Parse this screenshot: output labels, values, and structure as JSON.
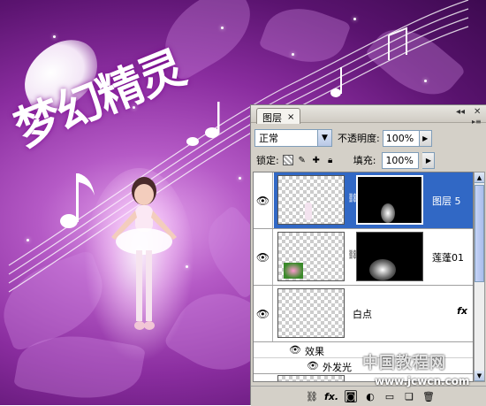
{
  "artwork": {
    "title_text": "梦幻精灵"
  },
  "panel": {
    "tab_label": "图层",
    "tab_close": "×",
    "blend_mode": "正常",
    "opacity_label": "不透明度:",
    "opacity_value": "100%",
    "lock_label": "锁定:",
    "fill_label": "填充:",
    "fill_value": "100%",
    "layers": [
      {
        "name": "图层 5",
        "selected": true
      },
      {
        "name": "莲蓬01",
        "selected": false
      },
      {
        "name": "白点",
        "selected": false,
        "fx": "fx"
      }
    ],
    "effects_label": "效果",
    "effect_item": "外发光",
    "bottom_fx": "fx."
  },
  "watermark": {
    "line1": "中国教程网",
    "line2": "www.jcwcn.com"
  },
  "colors": {
    "selection": "#3168c5",
    "panel_bg": "#d4d0c8",
    "bg_purple": "#8a2d9f"
  }
}
